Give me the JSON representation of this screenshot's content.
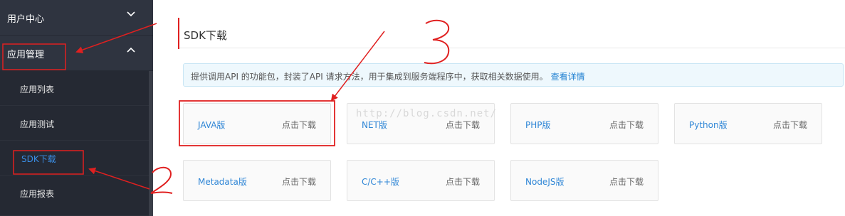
{
  "sidebar": {
    "user_center": "用户中心",
    "app_management": "应用管理",
    "items": [
      {
        "label": "应用列表"
      },
      {
        "label": "应用测试"
      },
      {
        "label": "SDK下载"
      },
      {
        "label": "应用报表"
      }
    ]
  },
  "main": {
    "title": "SDK下载",
    "info_text": "提供调用API 的功能包，封装了API 请求方法，用于集成到服务端程序中，获取相关数据使用。",
    "info_link": "查看详情",
    "cards": [
      {
        "name": "JAVA版",
        "action": "点击下载"
      },
      {
        "name": "NET版",
        "action": "点击下载"
      },
      {
        "name": "PHP版",
        "action": "点击下载"
      },
      {
        "name": "Python版",
        "action": "点击下载"
      },
      {
        "name": "Metadata版",
        "action": "点击下载"
      },
      {
        "name": "C/C++版",
        "action": "点击下载"
      },
      {
        "name": "NodeJS版",
        "action": "点击下载"
      }
    ]
  },
  "watermark": "http://blog.csdn.net/",
  "colors": {
    "sidebar_bg": "#2b2f3a",
    "active_item": "#3a8ee6",
    "link": "#1e7fd1",
    "annotation": "#e02020"
  }
}
